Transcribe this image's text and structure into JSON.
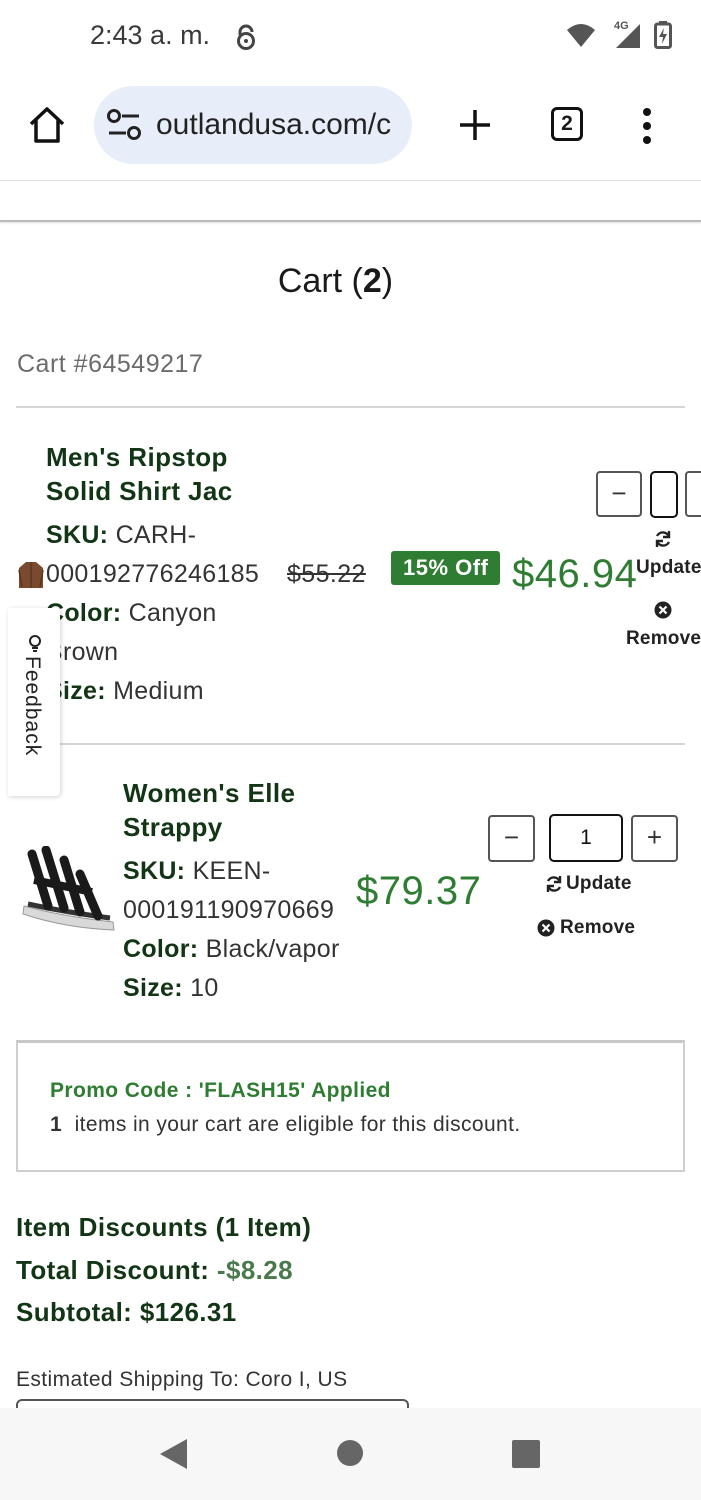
{
  "status_bar": {
    "time": "2:43 a. m.",
    "network": "4G"
  },
  "browser": {
    "url": "outlandusa.com/c",
    "tab_count": "2"
  },
  "cart": {
    "title_prefix": "Cart (",
    "count": "2",
    "title_suffix": ")",
    "number": "Cart #64549217"
  },
  "items": [
    {
      "name": "Men's Ripstop Solid Shirt Jac",
      "name_line1": "Men's Ripstop",
      "name_line2": "Solid Shirt Jac",
      "sku_label": "SKU:",
      "sku_line1": "CARH-",
      "sku_line2": "000192776246185",
      "original_price": "$55.22",
      "discount_badge": "15% Off",
      "price": "$46.94",
      "color_label": "Color:",
      "color_line1": "Canyon",
      "color_line2": "Brown",
      "size_label": "Size:",
      "size": "Medium",
      "update_label": "Update",
      "remove_label": "Remove",
      "thumbnail": "brown-jacket"
    },
    {
      "name": "Women's Elle Strappy",
      "name_line1": "Women's Elle",
      "name_line2": "Strappy",
      "sku_label": "SKU:",
      "sku_line1": "KEEN-",
      "sku_line2": "000191190970669",
      "price": "$79.37",
      "color_label": "Color:",
      "color": "Black/vapor",
      "size_label": "Size:",
      "size": "10",
      "quantity": "1",
      "update_label": "Update",
      "remove_label": "Remove",
      "thumbnail": "black-sandal"
    }
  ],
  "promo": {
    "title": "Promo Code : 'FLASH15' Applied",
    "eligible_count": "1",
    "eligible_text": "items in your cart are eligible for this discount."
  },
  "summary": {
    "item_discounts": "Item Discounts (1 Item)",
    "total_discount_label": "Total Discount:",
    "total_discount_value": "-$8.28",
    "subtotal": "Subtotal: $126.31"
  },
  "shipping": {
    "label": "Estimated Shipping To: Coro I, US"
  },
  "feedback": {
    "label": "Feedback"
  },
  "colors": {
    "accent_green": "#2e7d32",
    "dark_green": "#123515",
    "url_bg": "#e8eef9"
  },
  "icons": [
    "lock-icon",
    "wifi-icon",
    "signal-icon",
    "battery-icon",
    "home-icon",
    "site-settings-icon",
    "new-tab-icon",
    "menu-icon",
    "refresh-icon",
    "remove-icon",
    "lightbulb-icon",
    "back-icon",
    "home-circle-icon",
    "recents-icon"
  ]
}
